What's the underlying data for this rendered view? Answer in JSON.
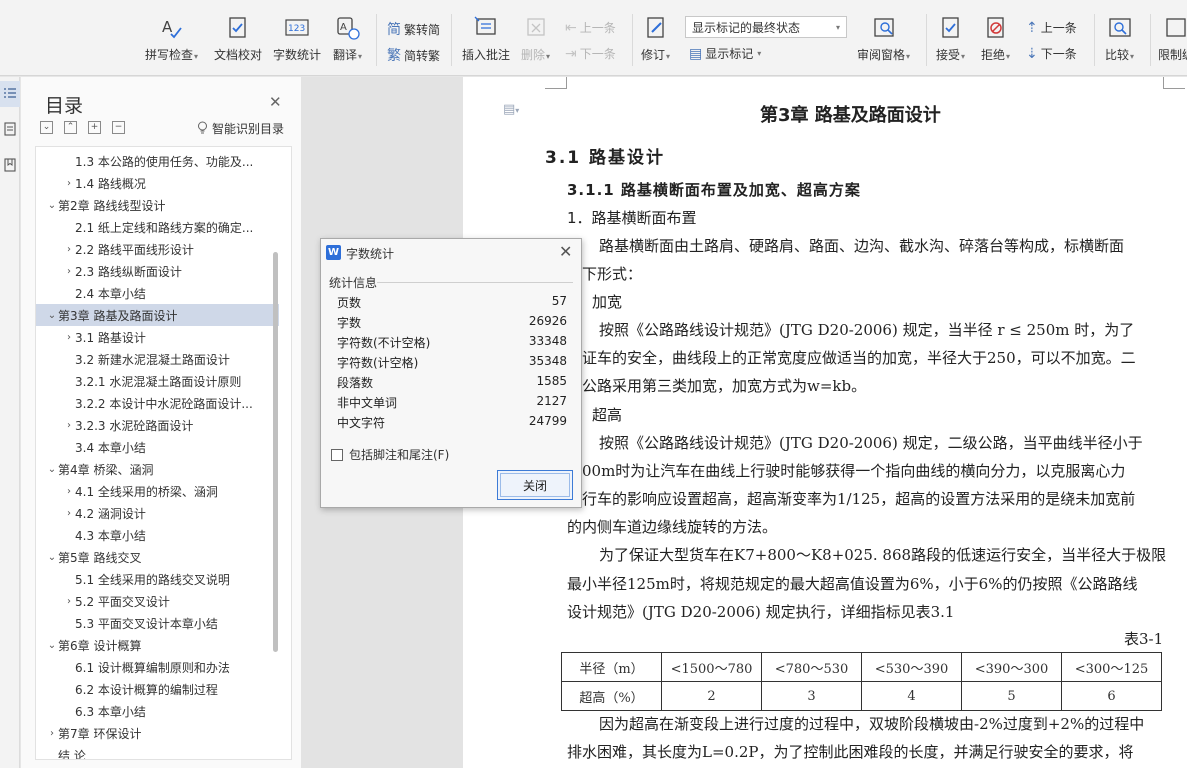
{
  "ribbon": {
    "spellcheck": "拼写检查",
    "proofread": "文档校对",
    "wordcount": "字数统计",
    "translate": "翻译",
    "to_traditional": "繁转简",
    "to_simplified": "简转繁",
    "insert_comment": "插入批注",
    "delete": "删除",
    "prev": "上一条",
    "next": "下一条",
    "revise": "修订",
    "markup_state": "显示标记的最终状态",
    "show_markup": "显示标记",
    "review_pane": "审阅窗格",
    "accept": "接受",
    "reject": "拒绝",
    "prev2": "上一条",
    "next2": "下一条",
    "compare": "比较",
    "restrict": "限制编"
  },
  "toc": {
    "title": "目录",
    "smart": "智能识别目录",
    "items": [
      {
        "text": "1.3 本公路的使用任务、功能及...",
        "level": 2,
        "arrow": ""
      },
      {
        "text": "1.4 路线概况",
        "level": 2,
        "arrow": "›"
      },
      {
        "text": "第2章  路线线型设计",
        "level": 1,
        "arrow": "⌄"
      },
      {
        "text": "2.1  纸上定线和路线方案的确定...",
        "level": 2,
        "arrow": ""
      },
      {
        "text": "2.2  路线平面线形设计",
        "level": 2,
        "arrow": "›"
      },
      {
        "text": "2.3  路线纵断面设计",
        "level": 2,
        "arrow": "›"
      },
      {
        "text": "2.4  本章小结",
        "level": 2,
        "arrow": ""
      },
      {
        "text": "第3章    路基及路面设计",
        "level": 1,
        "arrow": "⌄"
      },
      {
        "text": "3.1     路基设计",
        "level": 2,
        "arrow": "›"
      },
      {
        "text": "3.2 新建水泥混凝土路面设计",
        "level": 2,
        "arrow": ""
      },
      {
        "text": "3.2.1  水泥混凝土路面设计原则",
        "level": 2,
        "arrow": ""
      },
      {
        "text": "3.2.2  本设计中水泥砼路面设计...",
        "level": 2,
        "arrow": ""
      },
      {
        "text": "3.2.3  水泥砼路面设计",
        "level": 2,
        "arrow": "›"
      },
      {
        "text": "3.4  本章小结",
        "level": 2,
        "arrow": ""
      },
      {
        "text": "第4章    桥梁、涵洞",
        "level": 1,
        "arrow": "⌄"
      },
      {
        "text": "4.1  全线采用的桥梁、涵洞",
        "level": 2,
        "arrow": "›"
      },
      {
        "text": "4.2  涵洞设计",
        "level": 2,
        "arrow": "›"
      },
      {
        "text": "4.3  本章小结",
        "level": 2,
        "arrow": ""
      },
      {
        "text": "第5章  路线交叉",
        "level": 1,
        "arrow": "⌄"
      },
      {
        "text": "5.1  全线采用的路线交叉说明",
        "level": 2,
        "arrow": ""
      },
      {
        "text": "5.2  平面交叉设计",
        "level": 2,
        "arrow": "›"
      },
      {
        "text": "5.3  平面交叉设计本章小结",
        "level": 2,
        "arrow": ""
      },
      {
        "text": "第6章  设计概算",
        "level": 1,
        "arrow": "⌄"
      },
      {
        "text": "6.1  设计概算编制原则和办法",
        "level": 2,
        "arrow": ""
      },
      {
        "text": "6.2  本设计概算的编制过程",
        "level": 2,
        "arrow": ""
      },
      {
        "text": "6.3  本章小结",
        "level": 2,
        "arrow": ""
      },
      {
        "text": "第7章  环保设计",
        "level": 1,
        "arrow": "›"
      },
      {
        "text": "结  论",
        "level": 1,
        "arrow": ""
      }
    ]
  },
  "dialog": {
    "title": "字数统计",
    "section": "统计信息",
    "stats": [
      {
        "label": "页数",
        "value": "57"
      },
      {
        "label": "字数",
        "value": "26926"
      },
      {
        "label": "字符数(不计空格)",
        "value": "33348"
      },
      {
        "label": "字符数(计空格)",
        "value": "35348"
      },
      {
        "label": "段落数",
        "value": "1585"
      },
      {
        "label": "非中文单词",
        "value": "2127"
      },
      {
        "label": "中文字符",
        "value": "24799"
      }
    ],
    "checkbox": "包括脚注和尾注(F)",
    "close": "关闭"
  },
  "doc": {
    "chapter": "第3章    路基及路面设计",
    "h31": "3.1     路基设计",
    "h311": "3.1.1  路基横断面布置及加宽、超高方案",
    "h_1": "1．路基横断面布置",
    "p1a": "路基横断面由土路肩、硬路肩、路面、边沟、截水沟、碎落台等构成，标横断面",
    "p1b": "下形式：",
    "h_jk": "加宽",
    "p2a": "按照《公路路线设计规范》(JTG D20-2006) 规定，当半径 r ≤ 250m 时，为了",
    "p2b": "证车的安全，曲线段上的正常宽度应做适当的加宽，半径大于250，可以不加宽。二",
    "p2c": "公路采用第三类加宽，加宽方式为w=kb。",
    "h_cg": "超高",
    "p3a": "按照《公路路线设计规范》(JTG D20-2006) 规定，二级公路，当平曲线半径小于",
    "p3b": "00m时为让汽车在曲线上行驶时能够获得一个指向曲线的横向分力，以克服离心力",
    "p3c": "行车的影响应设置超高，超高渐变率为1/125，超高的设置方法采用的是绕未加宽前",
    "p3d": "的内侧车道边缘线旋转的方法。",
    "p4a": "为了保证大型货车在K7+800～K8+025. 868路段的低速运行安全，当半径大于极限",
    "p4b": "最小半径125m时，将规范规定的最大超高值设置为6%，小于6%的仍按照《公路路线",
    "p4c": "设计规范》(JTG D20-2006) 规定执行，详细指标见表3.1",
    "table_caption": "表3-1",
    "table": {
      "row1": [
        "半径（m）",
        "<1500～780",
        "<780～530",
        "<530～390",
        "<390～300",
        "<300～125"
      ],
      "row2": [
        "超高（%）",
        "2",
        "3",
        "4",
        "5",
        "6"
      ]
    },
    "p5a": "因为超高在渐变段上进行过度的过程中，双坡阶段横坡由-2%过度到+2%的过程中",
    "p5b": "排水困难，其长度为L=0.2P，为了控制此困难段的长度，并满足行驶安全的要求，将"
  }
}
